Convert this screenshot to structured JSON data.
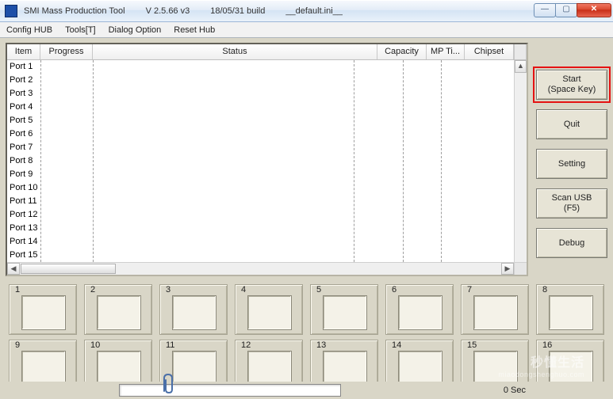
{
  "titlebar": {
    "app_name": "SMI Mass Production Tool",
    "version": "V 2.5.66  v3",
    "build": "18/05/31 build",
    "ini": "__default.ini__"
  },
  "window_controls": {
    "minimize_glyph": "—",
    "maximize_glyph": "▢",
    "close_glyph": "✕"
  },
  "menu": {
    "item1": "Config HUB",
    "item2": "Tools[T]",
    "item3": "Dialog Option",
    "item4": "Reset Hub"
  },
  "table": {
    "headers": {
      "item": "Item",
      "progress": "Progress",
      "status": "Status",
      "capacity": "Capacity",
      "mptime": "MP Ti...",
      "chipset": "Chipset"
    },
    "rows": [
      "Port 1",
      "Port 2",
      "Port 3",
      "Port 4",
      "Port 5",
      "Port 6",
      "Port 7",
      "Port 8",
      "Port 9",
      "Port 10",
      "Port 11",
      "Port 12",
      "Port 13",
      "Port 14",
      "Port 15"
    ]
  },
  "buttons": {
    "start_line1": "Start",
    "start_line2": "(Space Key)",
    "quit": "Quit",
    "setting": "Setting",
    "scan_line1": "Scan USB",
    "scan_line2": "(F5)",
    "debug": "Debug"
  },
  "slots": [
    1,
    2,
    3,
    4,
    5,
    6,
    7,
    8,
    9,
    10,
    11,
    12,
    13,
    14,
    15,
    16
  ],
  "status": {
    "seconds": "0 Sec"
  },
  "watermark": {
    "main": "秒懂生活",
    "sub": "miaodongshenghuo.com"
  }
}
